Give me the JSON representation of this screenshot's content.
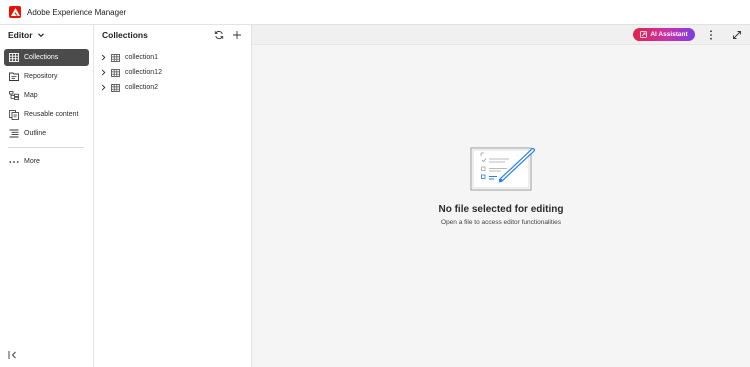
{
  "app": {
    "title": "Adobe Experience Manager",
    "brand_color": "#eb1000"
  },
  "sidebar": {
    "switcher_label": "Editor",
    "items": [
      {
        "label": "Collections",
        "icon": "grid-icon",
        "selected": true
      },
      {
        "label": "Repository",
        "icon": "repository-icon",
        "selected": false
      },
      {
        "label": "Map",
        "icon": "map-icon",
        "selected": false
      },
      {
        "label": "Reusable content",
        "icon": "reusable-content-icon",
        "selected": false
      },
      {
        "label": "Outline",
        "icon": "outline-icon",
        "selected": false
      }
    ],
    "more_label": "More"
  },
  "collections": {
    "title": "Collections",
    "items": [
      {
        "label": "collection1"
      },
      {
        "label": "collection12"
      },
      {
        "label": "collection2"
      }
    ]
  },
  "toolbar": {
    "ai_label": "AI Assistant",
    "ai_colors": [
      "#e0254b",
      "#c932a7",
      "#7b3fe4"
    ]
  },
  "empty_state": {
    "title": "No file selected for editing",
    "subtitle": "Open a file to access editor functionalities",
    "accent": "#2680eb"
  }
}
